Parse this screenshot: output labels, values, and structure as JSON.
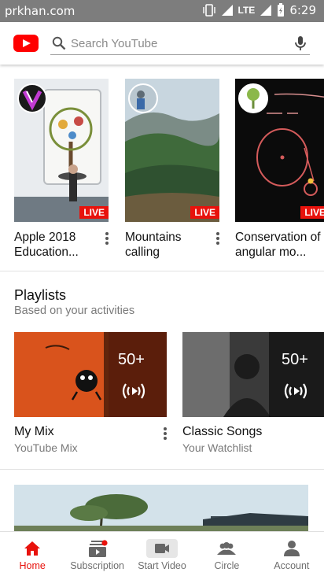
{
  "status_bar": {
    "carrier": "prkhan.com",
    "network": "LTE",
    "time": "6:29"
  },
  "header": {
    "search_placeholder": "Search YouTube"
  },
  "live_row": [
    {
      "title": "Apple 2018\nEducation...",
      "badge": "LIVE"
    },
    {
      "title": "Mountains\ncalling",
      "badge": "LIVE"
    },
    {
      "title": "Conservation of\nangular mo...",
      "badge": "LIVE"
    }
  ],
  "playlists": {
    "title": "Playlists",
    "subtitle": "Based on your activities",
    "items": [
      {
        "title": "My Mix",
        "subtitle": "YouTube Mix",
        "count": "50+"
      },
      {
        "title": "Classic Songs",
        "subtitle": "Your Watchlist",
        "count": "50+"
      }
    ]
  },
  "bottom_nav": [
    {
      "label": "Home",
      "icon": "home-icon",
      "active": true
    },
    {
      "label": "Subscription",
      "icon": "subscriptions-icon",
      "active": false
    },
    {
      "label": "Start Video",
      "icon": "video-camera-icon",
      "active": false
    },
    {
      "label": "Circle",
      "icon": "circle-people-icon",
      "active": false
    },
    {
      "label": "Account",
      "icon": "account-icon",
      "active": false
    }
  ],
  "colors": {
    "brand": "#ff0000",
    "live": "#e8120c",
    "active_tab": "#e8120c",
    "status_bar": "#7d7d7d"
  }
}
